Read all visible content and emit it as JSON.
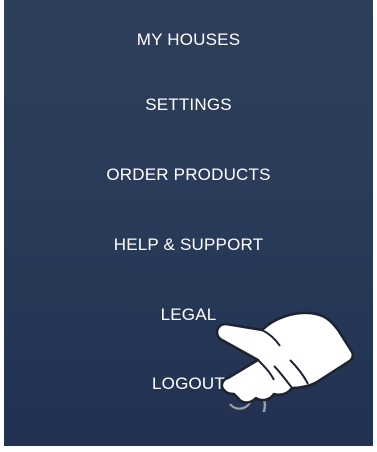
{
  "menu": {
    "items": [
      {
        "label": "MY HOUSES"
      },
      {
        "label": "SETTINGS"
      },
      {
        "label": "ORDER PRODUCTS"
      },
      {
        "label": "HELP & SUPPORT"
      },
      {
        "label": "LEGAL"
      },
      {
        "label": "LOGOUT"
      }
    ]
  },
  "colors": {
    "panel_top": "#2e3f5a",
    "panel_bottom": "#223152",
    "text": "#ffffff"
  },
  "icons": {
    "gesture": "tap-hand-icon"
  }
}
